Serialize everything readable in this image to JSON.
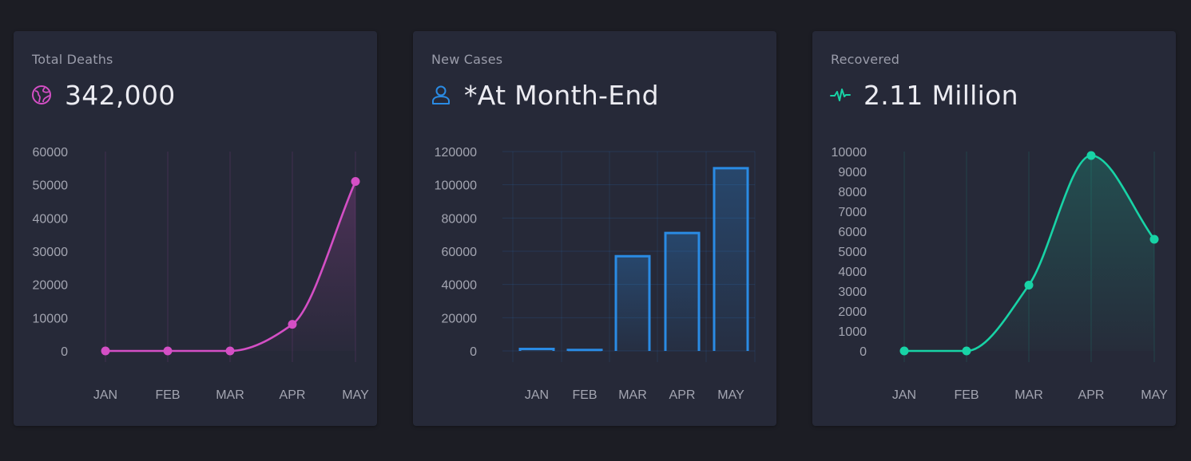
{
  "cards": [
    {
      "title": "Total Deaths",
      "value": "342,000",
      "icon": "globe-icon",
      "color": "#d44fc5"
    },
    {
      "title": "New Cases",
      "value": "*At Month-End",
      "icon": "user-icon",
      "color": "#2a8be4"
    },
    {
      "title": "Recovered",
      "value": "2.11 Million",
      "icon": "pulse-icon",
      "color": "#18d3a6"
    }
  ],
  "chart_data": [
    {
      "type": "area",
      "categories": [
        "JAN",
        "FEB",
        "MAR",
        "APR",
        "MAY"
      ],
      "values": [
        0,
        0,
        0,
        8000,
        51000
      ],
      "ylim": [
        0,
        60000
      ],
      "yticks": [
        0,
        10000,
        20000,
        30000,
        40000,
        50000,
        60000
      ],
      "grid": "vertical",
      "color": "#d44fc5"
    },
    {
      "type": "bar",
      "categories": [
        "JAN",
        "FEB",
        "MAR",
        "APR",
        "MAY"
      ],
      "values": [
        1200,
        600,
        57000,
        71000,
        110000
      ],
      "ylim": [
        0,
        120000
      ],
      "yticks": [
        0,
        20000,
        40000,
        60000,
        80000,
        100000,
        120000
      ],
      "grid": "both",
      "color": "#2a8be4"
    },
    {
      "type": "area",
      "categories": [
        "JAN",
        "FEB",
        "MAR",
        "APR",
        "MAY"
      ],
      "values": [
        0,
        0,
        3300,
        9800,
        5600
      ],
      "ylim": [
        0,
        10000
      ],
      "yticks": [
        0,
        1000,
        2000,
        3000,
        4000,
        5000,
        6000,
        7000,
        8000,
        9000,
        10000
      ],
      "grid": "vertical",
      "color": "#18d3a6"
    }
  ]
}
